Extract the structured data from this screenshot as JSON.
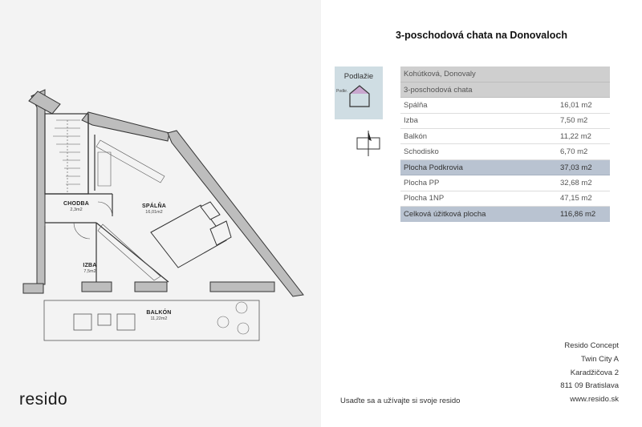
{
  "plan": {
    "rooms": [
      {
        "id": "chodba",
        "name": "CHODBA",
        "area": "2,3m2"
      },
      {
        "id": "spalna",
        "name": "SPÁLŇA",
        "area": "16,01m2"
      },
      {
        "id": "izba",
        "name": "IZBA",
        "area": "7,5m2"
      },
      {
        "id": "balkon",
        "name": "BALKÓN",
        "area": "11,22m2"
      }
    ],
    "brand": "resido"
  },
  "title": "3-poschodová chata na Donovaloch",
  "floor_card": {
    "label": "Podlažie",
    "small_label": "Podkr."
  },
  "table": {
    "rows": [
      {
        "label": "Kohútková, Donovaly",
        "value": "",
        "style": "hdr"
      },
      {
        "label": "3-poschodová chata",
        "value": "",
        "style": "hdr"
      },
      {
        "label": "Spálňa",
        "value": "16,01 m2",
        "style": ""
      },
      {
        "label": "Izba",
        "value": "7,50 m2",
        "style": ""
      },
      {
        "label": "Balkón",
        "value": "11,22 m2",
        "style": ""
      },
      {
        "label": "Schodisko",
        "value": "6,70 m2",
        "style": ""
      },
      {
        "label": "Plocha Podkrovia",
        "value": "37,03 m2",
        "style": "hl"
      },
      {
        "label": "Plocha PP",
        "value": "32,68 m2",
        "style": ""
      },
      {
        "label": "Plocha 1NP",
        "value": "47,15 m2",
        "style": ""
      },
      {
        "label": "Celková úžitková plocha",
        "value": "116,86 m2",
        "style": "hl"
      }
    ]
  },
  "footer": {
    "slogan": "Usaďte sa a užívajte si svoje resido",
    "address": [
      "Resido Concept",
      "Twin City A",
      "Karadžičova 2",
      "811 09 Bratislava",
      "www.resido.sk"
    ]
  },
  "colors": {
    "left_panel_bg": "#f3f3f3",
    "wall": "#bdbdbd",
    "header_row": "#cfcfcf",
    "highlight_row": "#b9c3d1",
    "floor_card": "#cfdde3",
    "floor_highlight": "#c9a7cf"
  },
  "icons": [
    "house-floor-icon",
    "compass-north-icon"
  ]
}
